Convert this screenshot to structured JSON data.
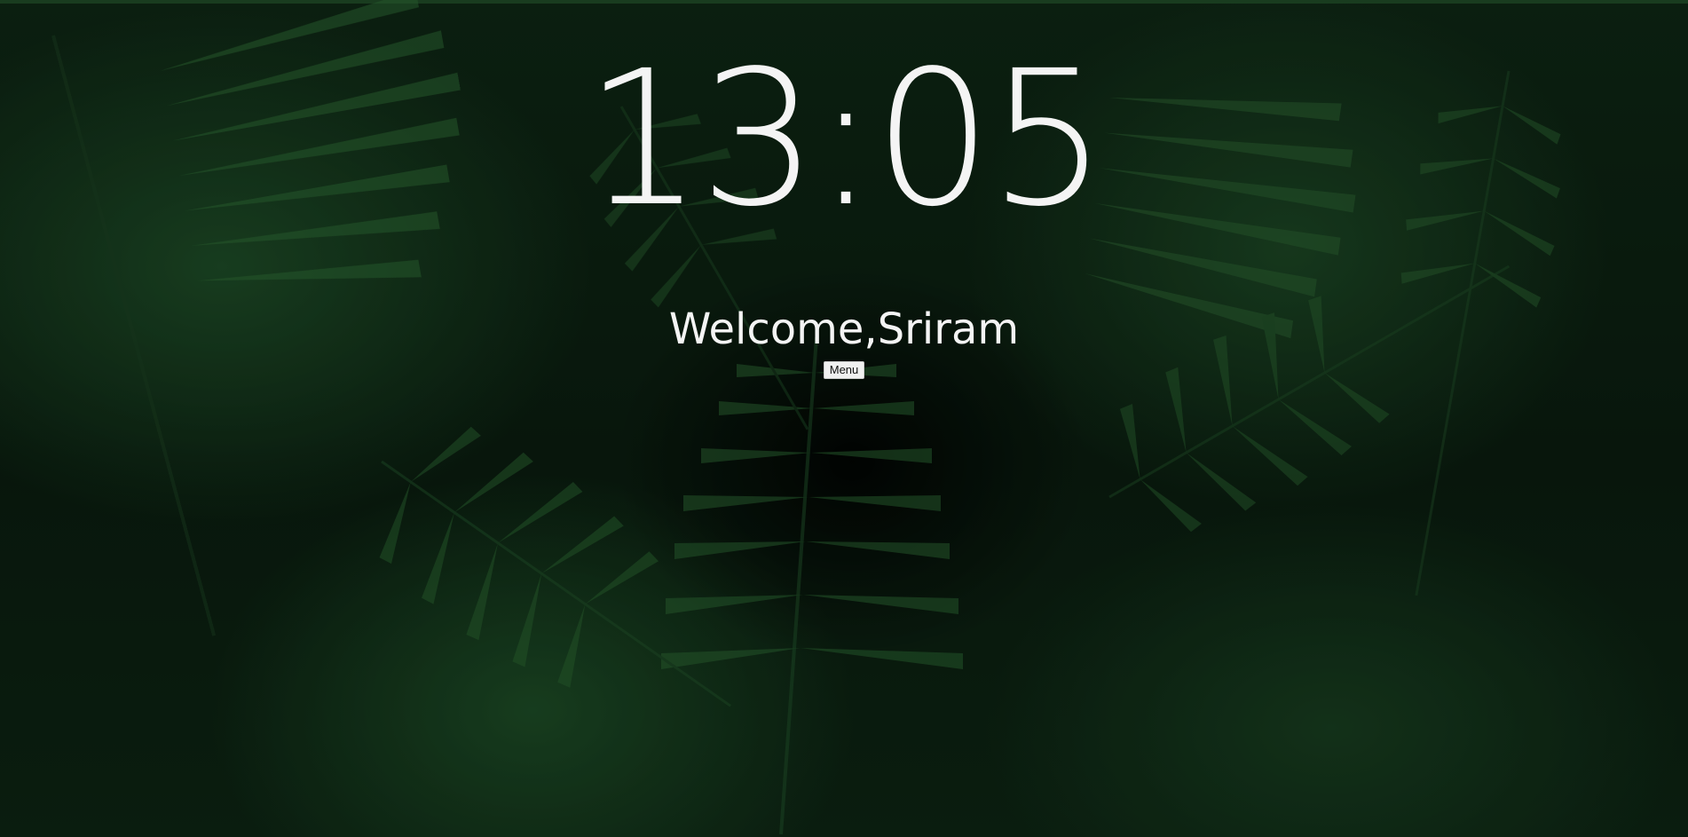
{
  "clock": {
    "time": "13:05"
  },
  "greeting": {
    "prefix": "Welcome,",
    "name": "Sriram"
  },
  "menu": {
    "label": "Menu"
  },
  "background": {
    "theme": "dark fern foliage",
    "colors": {
      "base": "#0a1c0f",
      "leaf": "#1f4a27",
      "text": "#f4f4f4"
    }
  }
}
